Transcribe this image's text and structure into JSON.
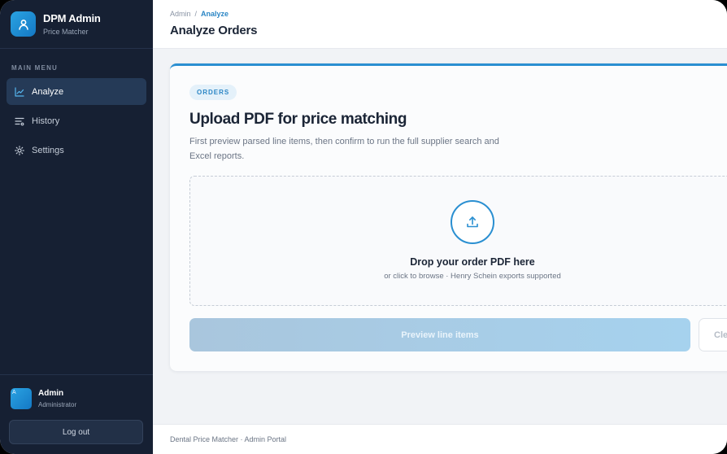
{
  "brand": {
    "title": "DPM Admin",
    "subtitle": "Price Matcher",
    "logo_icon": "user-icon"
  },
  "sidebar": {
    "menu_label": "MAIN MENU",
    "items": [
      {
        "label": "Analyze",
        "icon": "chart-line-icon",
        "active": true
      },
      {
        "label": "History",
        "icon": "list-filter-icon",
        "active": false
      },
      {
        "label": "Settings",
        "icon": "sun-gear-icon",
        "active": false
      }
    ],
    "user": {
      "avatar_letter": "A",
      "name": "Admin",
      "role": "Administrator"
    },
    "logout_label": "Log out"
  },
  "header": {
    "breadcrumb": [
      "Admin",
      "Analyze"
    ],
    "breadcrumb_sep": "/",
    "title": "Analyze Orders"
  },
  "card": {
    "badge": "ORDERS",
    "title": "Upload PDF for price matching",
    "description": "First preview parsed line items, then confirm to run the full supplier search and Excel reports.",
    "dropzone": {
      "icon": "upload-icon",
      "title": "Drop your order PDF here",
      "subtitle": "or click to browse · Henry Schein exports supported"
    },
    "preview_button": "Preview line items",
    "clear_button": "Cle"
  },
  "footer": {
    "text": "Dental Price Matcher · Admin Portal"
  },
  "colors": {
    "sidebar_bg": "#162033",
    "accent": "#2a8fd1",
    "active_item_bg": "#253a57"
  }
}
